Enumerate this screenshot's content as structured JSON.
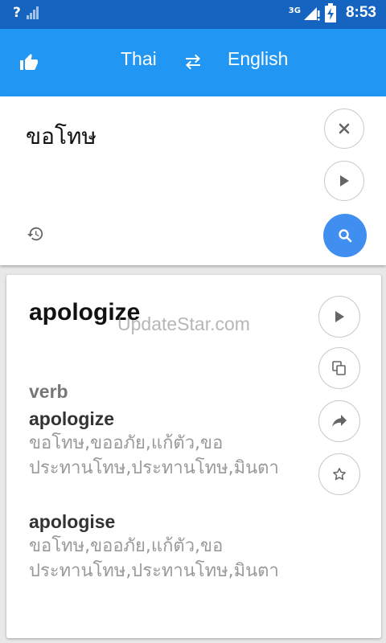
{
  "status_bar": {
    "signal_unknown": "?",
    "network_type": "3G",
    "time": "8:53"
  },
  "app_bar": {
    "source_language": "Thai",
    "target_language": "English",
    "icons": [
      "thumbs-up-icon",
      "swap-icon"
    ]
  },
  "input": {
    "text": "ขอโทษ",
    "icons": [
      "close-icon",
      "play-icon",
      "history-icon",
      "search-icon"
    ]
  },
  "result": {
    "translation": "apologize",
    "watermark": "UpdateStar.com",
    "part_of_speech": "verb",
    "entries": [
      {
        "word": "apologize",
        "synonyms": "ขอโทษ,ขออภัย,แก้ตัว,ขอประทานโทษ,ประทานโทษ,มินตา"
      },
      {
        "word": "apologise",
        "synonyms": "ขอโทษ,ขออภัย,แก้ตัว,ขอประทานโทษ,ประทานโทษ,มินตา"
      }
    ],
    "icons": [
      "play-icon",
      "copy-icon",
      "share-icon",
      "star-icon"
    ]
  },
  "colors": {
    "status_bar": "#1565c0",
    "app_bar": "#2196f3",
    "search_button": "#3f8ef0"
  }
}
